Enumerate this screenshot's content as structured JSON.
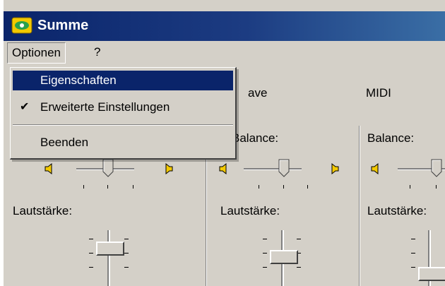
{
  "window": {
    "title": "Summe"
  },
  "menubar": {
    "items": [
      "Optionen",
      "?"
    ]
  },
  "dropdown": {
    "items": [
      {
        "label": "Eigenschaften",
        "checked": false,
        "selected": true
      },
      {
        "label": "Erweiterte Einstellungen",
        "checked": true,
        "selected": false
      },
      {
        "label": "Beenden",
        "checked": false,
        "selected": false
      }
    ],
    "check_glyph": "✔"
  },
  "channels": {
    "headers": [
      "Wave",
      "MIDI"
    ],
    "partial_headers": [
      "ave"
    ],
    "balance_label": "Balance:",
    "volume_label": "Lautstärke:"
  },
  "colors": {
    "titlebar": "#0a246a",
    "window_bg": "#d4d0c8",
    "highlight": "#0a246a"
  }
}
